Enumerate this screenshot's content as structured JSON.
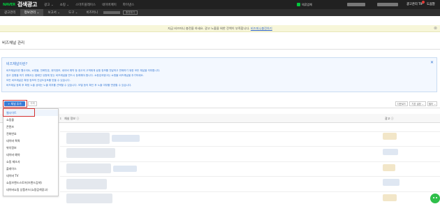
{
  "topbar": {
    "brand": "NAVER",
    "product": "검색광고",
    "nav": [
      "광고 ⌄",
      "쇼핑 ⌄",
      "스마트플레이스",
      "네이버페이",
      "파이낸스"
    ],
    "account_label": "의류업체",
    "tip_label": "광고관리 TIP",
    "help_label": "도움말"
  },
  "menubar": {
    "items": [
      {
        "label": "광고관리",
        "active": false
      },
      {
        "label": "정보관리 ⌄",
        "active": true
      },
      {
        "label": "보고서 ⌄",
        "active": false
      },
      {
        "label": "도구 ⌄",
        "active": false
      },
      {
        "label": "비즈머니",
        "active": false
      }
    ],
    "shortcut_label": "충전하기"
  },
  "notice": {
    "text": "지금 비즈머니 충전을 하세요. 광고 노출을 위한 잔액이 부족합니다.",
    "link": "비즈머니충전하기"
  },
  "page": {
    "title": "비즈채널 관리"
  },
  "infobox": {
    "title": "비즈채널이란?",
    "lines": [
      "비즈채널이란 웹사이트, 쇼핑몰, 전화번호, 위치정보, 네이버 예약 등 광고의 고객에게 상품 정보를 전달하고 판매하기 위한 모든 채널을 의미합니다.",
      "광고 집행을 하기 위해서는 캠페인 유형에 맞는 비즈채널을 반드시 등록해야 합니다. 쇼핑검색광고는 쇼핑몰 비즈채널을 추가하세요.",
      "모든 비즈채널은 확정 정보의 간섭도검토를 받을 수 있습니다.",
      "비즈채널 등록 후 확정 노출 상태는 노출 여부를 선택할 수 있습니다. 모델 등의 확인 후 노출 여부를 변경할 수 있습니다."
    ]
  },
  "toolbar": {
    "add_label": "+ 채널 추가",
    "delete_label": "삭제",
    "download_label": "다운로드",
    "basic_label": "기본 설정 ⌄",
    "filter_label": "필터 ⌄"
  },
  "table": {
    "col_info": "채널 정보 ⓘ",
    "col_count": "광고 ⓘ",
    "col_mark": "⇕"
  },
  "dropdown": {
    "items": [
      "웹사이트",
      "쇼핑몰",
      "콘텐츠",
      "전화번호",
      "네이버 톡톡",
      "위치정보",
      "네이버 예약",
      "쇼핑 제조사",
      "플레이스",
      "네이버 TV",
      "쇼핑브랜드스토어(브랜드검색)",
      "네이버쇼핑 상품카드(쇼핑검색광고)"
    ]
  },
  "colors": {
    "accent": "#3a7bd5",
    "highlight": "#d32f2f",
    "brand_green": "#00c73c"
  }
}
